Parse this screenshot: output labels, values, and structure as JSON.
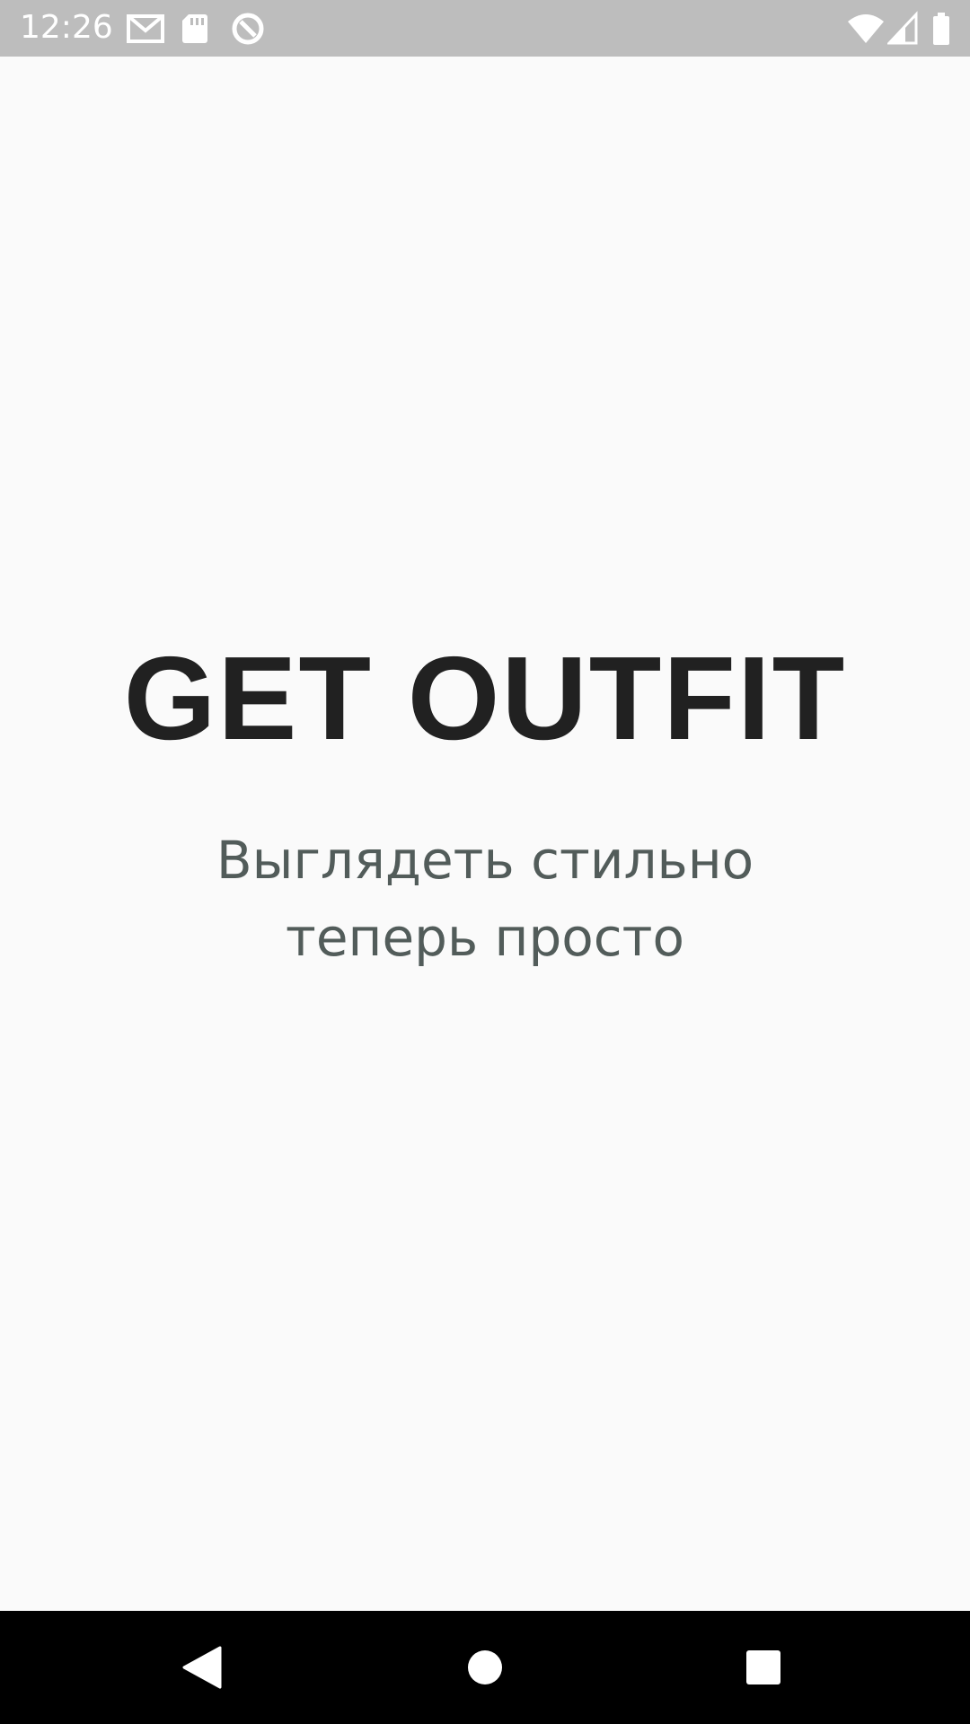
{
  "status_bar": {
    "time": "12:26",
    "left_icons": [
      "gmail-icon",
      "sd-card-icon",
      "data-saver-icon"
    ],
    "right_icons": [
      "wifi-icon",
      "cell-signal-icon",
      "battery-icon"
    ],
    "background": "#BDBDBD"
  },
  "splash": {
    "title": "GET OUTFIT",
    "tagline_line1": "Выглядеть стильно",
    "tagline_line2": "теперь просто",
    "title_color": "#212121",
    "tagline_color": "#525C5A",
    "background": "#FAFAFA"
  },
  "nav_bar": {
    "buttons": [
      "back-icon",
      "home-icon",
      "recents-icon"
    ],
    "background": "#000000"
  }
}
